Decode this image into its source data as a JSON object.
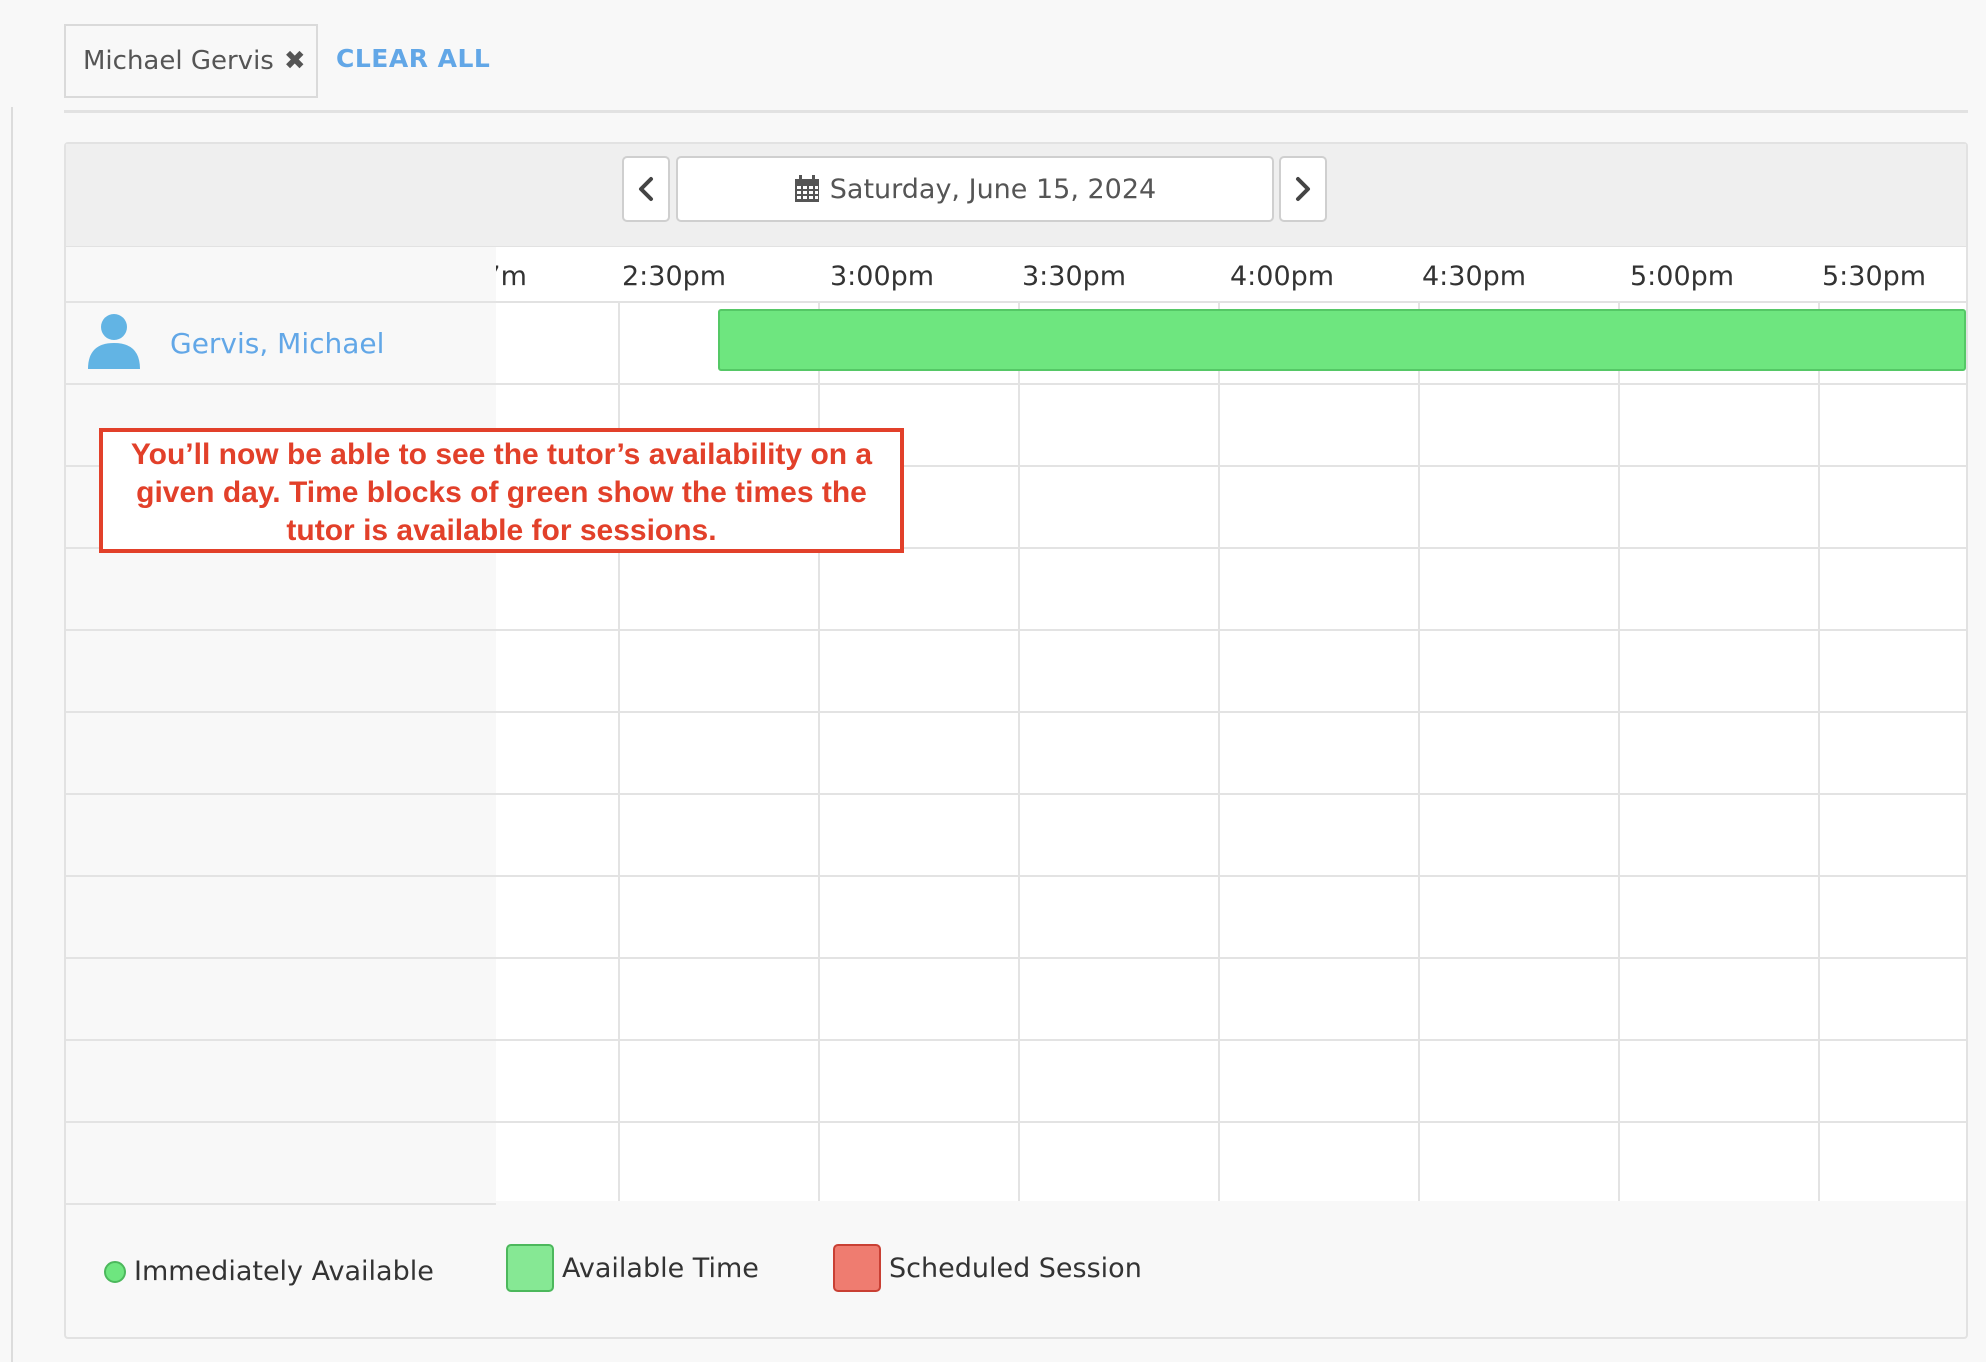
{
  "filters": {
    "chip_label": "Michael Gervis",
    "chip_remove_icon": "close-icon",
    "clear_all_label": "CLEAR ALL"
  },
  "date_nav": {
    "prev_icon": "chevron-left-icon",
    "next_icon": "chevron-right-icon",
    "calendar_icon": "calendar-icon",
    "date_label": "Saturday, June 15, 2024"
  },
  "timeline": {
    "time_labels": [
      "’m",
      "2:30pm",
      "3:00pm",
      "3:30pm",
      "4:00pm",
      "4:30pm",
      "5:00pm",
      "5:30pm"
    ],
    "tutor_name": "Gervis, Michael",
    "tutor_icon": "user-icon",
    "available_block_color": "#6ee67f"
  },
  "callout": {
    "text": "You’ll now be able to see the tutor’s availability on a given day. Time blocks of green show the times the tutor is available for sessions."
  },
  "legend": {
    "immediately_available": "Immediately Available",
    "available_time": "Available Time",
    "scheduled_session": "Scheduled Session",
    "colors": {
      "available": "#6ee67f",
      "scheduled": "#ef7c70"
    }
  }
}
